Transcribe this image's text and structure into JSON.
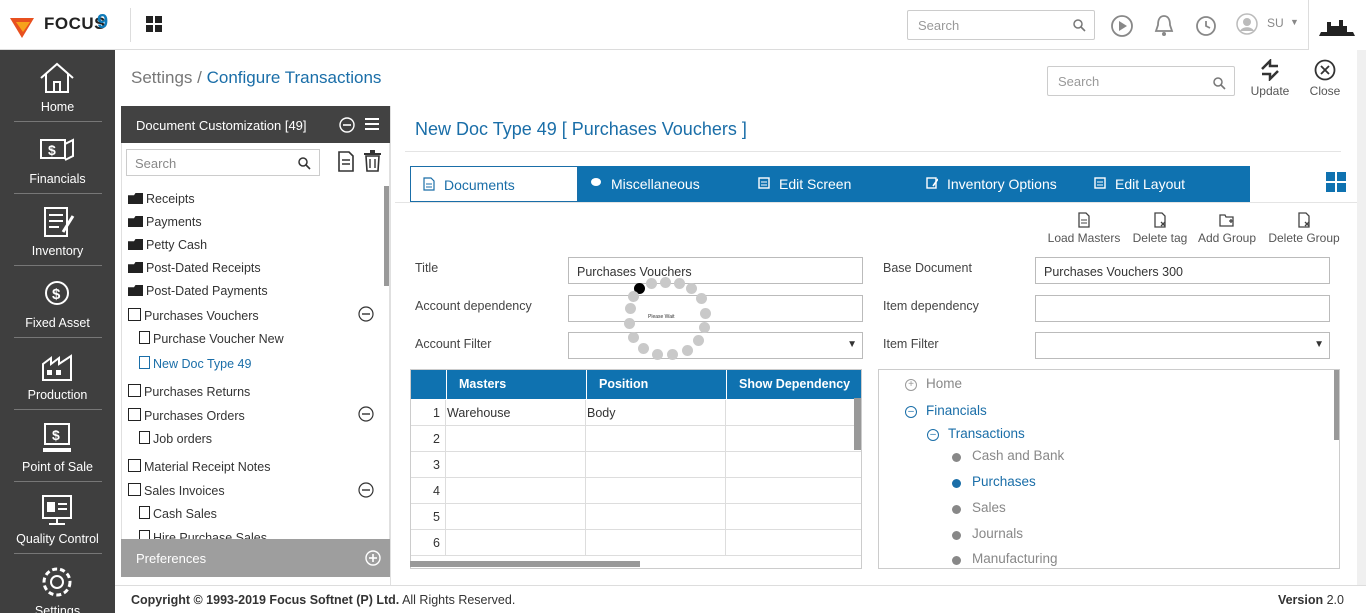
{
  "app": {
    "logo_text": "FOCUS",
    "logo_nine": "9",
    "search_placeholder": "Search",
    "user": "SU"
  },
  "sidebar": {
    "items": [
      {
        "label": "Home"
      },
      {
        "label": "Financials"
      },
      {
        "label": "Inventory"
      },
      {
        "label": "Fixed Asset"
      },
      {
        "label": "Production"
      },
      {
        "label": "Point of Sale"
      },
      {
        "label": "Quality Control"
      },
      {
        "label": "Settings"
      }
    ]
  },
  "breadcrumb": {
    "parent": "Settings",
    "separator": " / ",
    "current": "Configure Transactions"
  },
  "header_tools": {
    "search_placeholder": "Search",
    "update_label": "Update",
    "close_label": "Close"
  },
  "left_panel": {
    "title": "Document Customization [49]",
    "search_placeholder": "Search",
    "tree": [
      {
        "label": "Receipts"
      },
      {
        "label": "Payments"
      },
      {
        "label": "Petty Cash"
      },
      {
        "label": "Post-Dated Receipts"
      },
      {
        "label": "Post-Dated Payments"
      },
      {
        "label": "Purchases Vouchers"
      },
      {
        "label": "Purchase Voucher New"
      },
      {
        "label": "New Doc Type 49"
      },
      {
        "label": "Purchases Returns"
      },
      {
        "label": "Purchases Orders"
      },
      {
        "label": "Job orders"
      },
      {
        "label": "Material Receipt Notes"
      },
      {
        "label": "Sales Invoices"
      },
      {
        "label": "Cash Sales"
      },
      {
        "label": "Hire Purchase Sales"
      }
    ],
    "preferences_label": "Preferences"
  },
  "main": {
    "title": "New Doc Type 49 [ Purchases Vouchers ]",
    "tabs": [
      {
        "label": "Documents"
      },
      {
        "label": "Miscellaneous"
      },
      {
        "label": "Edit Screen"
      },
      {
        "label": "Inventory Options"
      },
      {
        "label": "Edit Layout"
      }
    ],
    "tools": [
      {
        "label": "Load Masters"
      },
      {
        "label": "Delete tag"
      },
      {
        "label": "Add Group"
      },
      {
        "label": "Delete Group"
      }
    ],
    "fields": {
      "title_label": "Title",
      "title_value": "Purchases Vouchers",
      "account_dep_label": "Account dependency",
      "account_dep_value": "",
      "account_filter_label": "Account Filter",
      "account_filter_value": "",
      "base_doc_label": "Base Document",
      "base_doc_value": "Purchases Vouchers 300",
      "item_dep_label": "Item dependency",
      "item_dep_value": "",
      "item_filter_label": "Item Filter",
      "item_filter_value": ""
    },
    "loading_text": "Please Wait",
    "grid": {
      "headers": [
        "Masters",
        "Position",
        "Show Dependency"
      ],
      "rows": [
        {
          "n": "1",
          "masters": "Warehouse",
          "position": "Body",
          "dep": ""
        },
        {
          "n": "2",
          "masters": "",
          "position": "",
          "dep": ""
        },
        {
          "n": "3",
          "masters": "",
          "position": "",
          "dep": ""
        },
        {
          "n": "4",
          "masters": "",
          "position": "",
          "dep": ""
        },
        {
          "n": "5",
          "masters": "",
          "position": "",
          "dep": ""
        },
        {
          "n": "6",
          "masters": "",
          "position": "",
          "dep": ""
        }
      ]
    },
    "menu_tree": {
      "home": "Home",
      "financials": "Financials",
      "transactions": "Transactions",
      "items": [
        "Cash and Bank",
        "Purchases",
        "Sales",
        "Journals",
        "Manufacturing"
      ]
    }
  },
  "footer": {
    "copyright_bold": "Copyright © 1993-2019 Focus Softnet (P) Ltd.",
    "copyright_rest": " All Rights Reserved.",
    "version_label": "Version",
    "version_value": "2.0"
  },
  "colors": {
    "accent": "#0f72b0",
    "sidebar": "#3f3f3f",
    "title": "#1a6ea8"
  }
}
